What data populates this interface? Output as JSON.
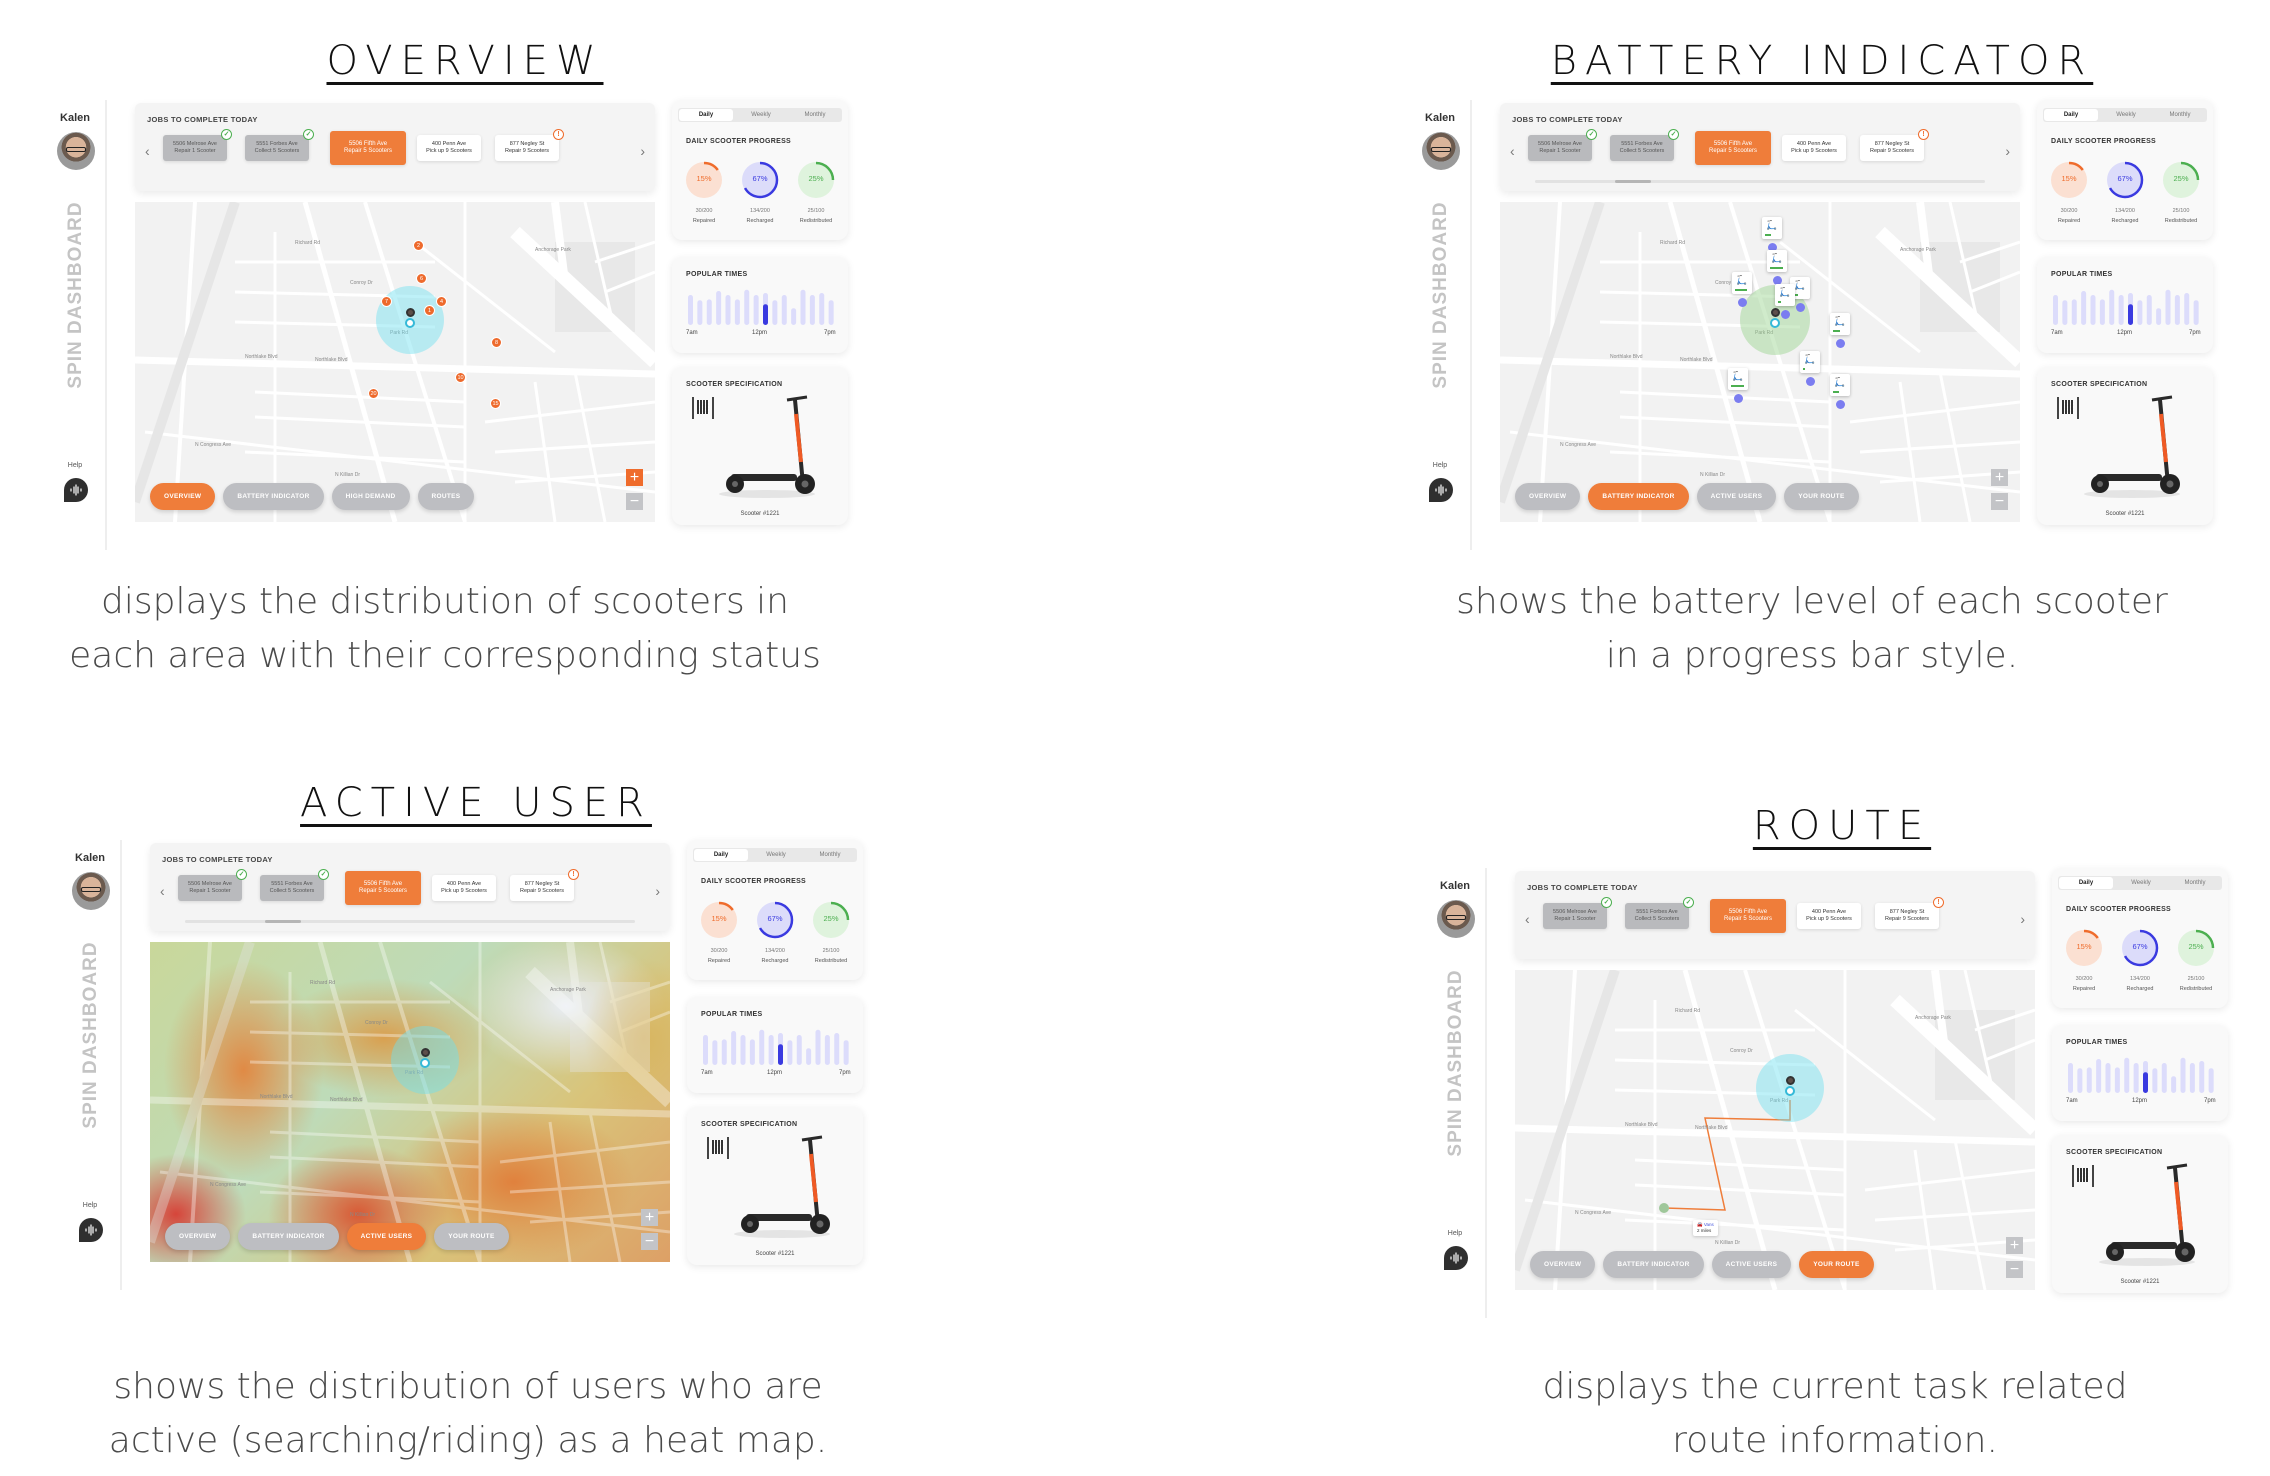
{
  "sections": [
    {
      "id": "overview",
      "title": "OVERVIEW",
      "caption": [
        "displays the distribution of scooters in",
        "each area with their corresponding status"
      ],
      "map_mode": "markers",
      "scroll": false,
      "zoom_plus_orange": true,
      "map_buttons": [
        "OVERVIEW",
        "BATTERY INDICATOR",
        "HIGH DEMAND",
        "ROUTES"
      ],
      "active_button": 0,
      "markers": [
        "2",
        "6",
        "7",
        "4",
        "1",
        "8",
        "10",
        "20",
        "15"
      ]
    },
    {
      "id": "battery-indicator",
      "title": "BATTERY INDICATOR",
      "caption": [
        "shows the battery level of each scooter",
        "in a progress bar style."
      ],
      "map_mode": "battery",
      "scroll": true,
      "zoom_plus_orange": false,
      "map_buttons": [
        "OVERVIEW",
        "BATTERY INDICATOR",
        "ACTIVE USERS",
        "YOUR ROUTE"
      ],
      "active_button": 1,
      "battery_levels": [
        0.4,
        0.9,
        0.85,
        0.35,
        0.2,
        0.5,
        0.15,
        0.9,
        0.45
      ]
    },
    {
      "id": "active-user",
      "title": "ACTIVE USER",
      "caption": [
        "shows the distribution of users who are",
        "active (searching/riding) as a heat map."
      ],
      "map_mode": "heatmap",
      "scroll": true,
      "zoom_plus_orange": false,
      "map_buttons": [
        "OVERVIEW",
        "BATTERY INDICATOR",
        "ACTIVE USERS",
        "YOUR ROUTE"
      ],
      "active_button": 2
    },
    {
      "id": "route",
      "title": "ROUTE",
      "caption": [
        "displays the current task related",
        "route information."
      ],
      "map_mode": "route",
      "scroll": false,
      "zoom_plus_orange": false,
      "map_buttons": [
        "OVERVIEW",
        "BATTERY INDICATOR",
        "ACTIVE USERS",
        "YOUR ROUTE"
      ],
      "active_button": 3,
      "route_callout": {
        "mode": "Vans",
        "distance": "2 miles"
      }
    }
  ],
  "sidebar": {
    "user_name": "Kalen",
    "brand": "SPIN DASHBOARD",
    "help_label": "Help"
  },
  "jobs": {
    "title": "JOBS TO COMPLETE TODAY",
    "items": [
      {
        "address": "5506 Melrose Ave",
        "task": "Repair 1 Scooter",
        "status": "done"
      },
      {
        "address": "5551 Forbes Ave",
        "task": "Collect 5 Scooters",
        "status": "done"
      },
      {
        "address": "5506 Fifth Ave",
        "task": "Repair 5 Scooters",
        "status": "active"
      },
      {
        "address": "400 Penn Ave",
        "task": "Pick up 9 Scooters",
        "status": "pending"
      },
      {
        "address": "877 Negley St",
        "task": "Repair 9 Scooters",
        "status": "alert"
      }
    ]
  },
  "progress": {
    "tabs": [
      "Daily",
      "Weekly",
      "Monthly"
    ],
    "active_tab": 0,
    "title": "DAILY SCOOTER PROGRESS",
    "rings": [
      {
        "percent": "15%",
        "value": 0.15,
        "count": "30/200",
        "label": "Repaired",
        "color": "#ef6c2c",
        "fill": "#fbe0d2"
      },
      {
        "percent": "67%",
        "value": 0.67,
        "count": "134/200",
        "label": "Recharged",
        "color": "#3a3ae0",
        "fill": "#dcdcfa"
      },
      {
        "percent": "25%",
        "value": 0.25,
        "count": "25/100",
        "label": "Redistributed",
        "color": "#4caf50",
        "fill": "#dff3dd"
      }
    ]
  },
  "popular_times": {
    "title": "POPULAR TIMES",
    "labels": [
      "7am",
      "12pm",
      "7pm"
    ],
    "bars": [
      0.75,
      0.62,
      0.64,
      0.85,
      0.75,
      0.64,
      0.88,
      0.75,
      0.8,
      0.62,
      0.75,
      0.42,
      0.88,
      0.75,
      0.8,
      0.62
    ],
    "highlight_index": 8,
    "highlight_value": 0.52,
    "colors": {
      "bar": "#dcdcfb",
      "highlight": "#3a3ae0"
    }
  },
  "scooter_spec": {
    "title": "SCOOTER SPECIFICATION",
    "scooter_id": "Scooter #1221"
  },
  "map_labels": [
    "Northlake Blvd",
    "Northlake Blvd",
    "Anchorage Park",
    "Richard Rd",
    "Conroy Dr",
    "Park Rd",
    "N Congress Ave",
    "N Killian Dr"
  ],
  "colors": {
    "accent": "#ef7d3a",
    "inactive_button": "#bdbec2",
    "marker": "#ee6a2c",
    "battery_dot": "#7b7df0"
  }
}
